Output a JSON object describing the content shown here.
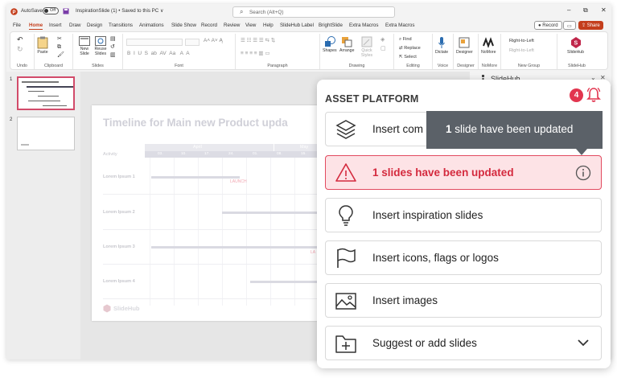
{
  "titlebar": {
    "autosave_label": "AutoSave",
    "autosave_state": "Off",
    "doc_title": "InspirationSlide (1) • Saved to this PC ∨",
    "search_placeholder": "Search (Alt+Q)",
    "minimize": "–",
    "restore": "⧉",
    "close": "✕"
  },
  "menu": {
    "items": [
      "File",
      "Home",
      "Insert",
      "Draw",
      "Design",
      "Transitions",
      "Animations",
      "Slide Show",
      "Record",
      "Review",
      "View",
      "Help",
      "SlideHub Label",
      "BrightSlide",
      "Extra Macros",
      "Extra Macros"
    ],
    "active": "Home",
    "record_label": "Record",
    "share_label": "Share"
  },
  "ribbon": {
    "groups": [
      {
        "label": "Undo"
      },
      {
        "label": "Clipboard"
      },
      {
        "label": "Slides"
      },
      {
        "label": "Font"
      },
      {
        "label": "Paragraph"
      },
      {
        "label": "Drawing"
      },
      {
        "label": "Editing"
      },
      {
        "label": "Voice"
      },
      {
        "label": "Designer"
      },
      {
        "label": "NoMore"
      },
      {
        "label": "New Group"
      },
      {
        "label": "SlideHub"
      }
    ],
    "paste": "Paste",
    "new_slide": "New Slide",
    "reuse_slides": "Reuse Slides",
    "shapes": "Shapes",
    "arrange": "Arrange",
    "quick_styles": "Quick Styles",
    "find": "Find",
    "replace": "Replace",
    "select": "Select",
    "dictate": "Dictate",
    "designer": "Designer",
    "nomore": "NoMore",
    "rtl": "Right-to-Left",
    "rtl2": "Right-to-Left",
    "slidehub": "SlideHub"
  },
  "thumbnails": [
    {
      "number": "1"
    },
    {
      "number": "2"
    }
  ],
  "slide": {
    "title": "Timeline for Main new Product upda",
    "activity_label": "Activity",
    "months": [
      "April",
      "May"
    ],
    "weeks": [
      "03.",
      "10.",
      "17.",
      "24.",
      "01.",
      "08.",
      "15.",
      "22."
    ],
    "rows": [
      "Lorem Ipsum 1",
      "Lorem Ipsum 2",
      "Lorem Ipsum 3",
      "Lorem Ipsum 4"
    ],
    "launch_label": "LAUNCH",
    "launch_label2": "LA",
    "logo_text": "SlideHub"
  },
  "side_panel": {
    "title": "SlideHub"
  },
  "asset_platform": {
    "title": "ASSET PLATFORM",
    "badge": "4",
    "cards": [
      {
        "label": "Insert com",
        "icon": "layers-icon"
      },
      {
        "label": "1 slides have been updated",
        "icon": "warning-icon"
      },
      {
        "label": "Insert inspiration slides",
        "icon": "lightbulb-icon"
      },
      {
        "label": "Insert icons, flags or logos",
        "icon": "flag-icon"
      },
      {
        "label": "Insert images",
        "icon": "image-icon"
      },
      {
        "label": "Suggest or add slides",
        "icon": "folder-add-icon"
      }
    ],
    "tooltip_count": "1",
    "tooltip_text": " slide have been updated",
    "accent_color": "#e2354f"
  }
}
